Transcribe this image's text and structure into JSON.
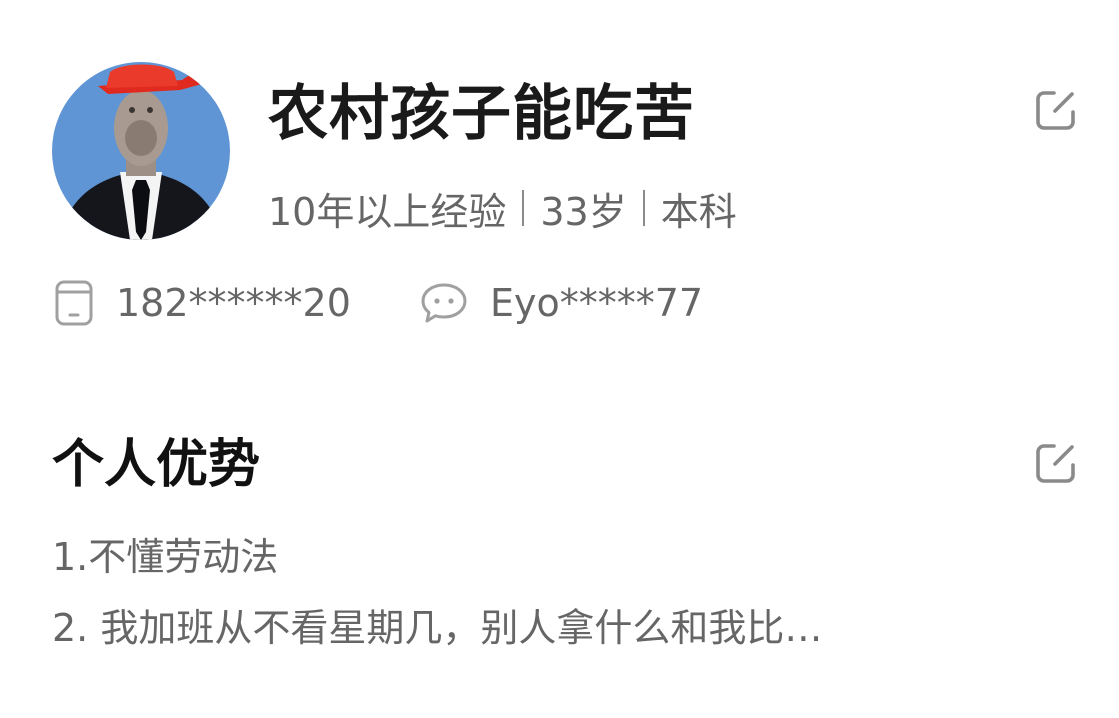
{
  "profile": {
    "name": "农村孩子能吃苦",
    "experience": "10年以上经验",
    "age": "33岁",
    "education": "本科",
    "phone": "182******20",
    "wechat": "Eyo*****77"
  },
  "advantages": {
    "title": "个人优势",
    "lines": [
      "1.不懂劳动法",
      "2. 我加班从不看星期几，别人拿什么和我比…"
    ]
  },
  "icons": {
    "edit": "edit-icon",
    "phone": "phone-icon",
    "wechat": "chat-bubble-icon"
  },
  "colors": {
    "title": "#1a1a1a",
    "secondary_text": "#666666",
    "icon_gray": "#9a9a9a",
    "avatar_background": "#5f95d4",
    "hat_red": "#e02a1f"
  }
}
